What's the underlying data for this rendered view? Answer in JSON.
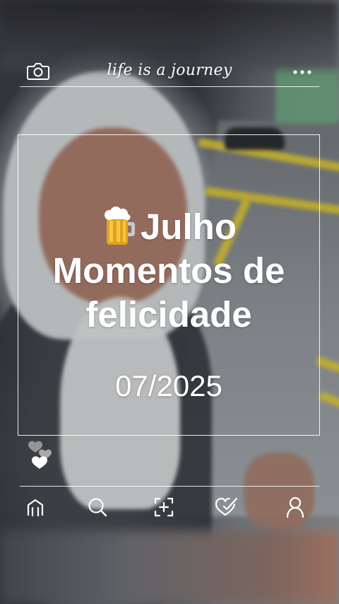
{
  "header": {
    "brand_text": "life is a journey",
    "camera_icon": "camera-icon",
    "more_icon": "more-dots-icon"
  },
  "post": {
    "emoji": "beer-mug-emoji",
    "title_line1": "Julho",
    "title_line2": "Momentos de",
    "title_line3": "felicidade",
    "date": "07/2025"
  },
  "reactions": {
    "icon": "hearts-icon"
  },
  "nav": {
    "items": [
      {
        "icon": "home-icon"
      },
      {
        "icon": "search-icon"
      },
      {
        "icon": "add-icon"
      },
      {
        "icon": "heart-check-icon"
      },
      {
        "icon": "profile-icon"
      }
    ]
  },
  "colors": {
    "text": "#ffffff",
    "highlight_yellow": "#d8c233"
  }
}
